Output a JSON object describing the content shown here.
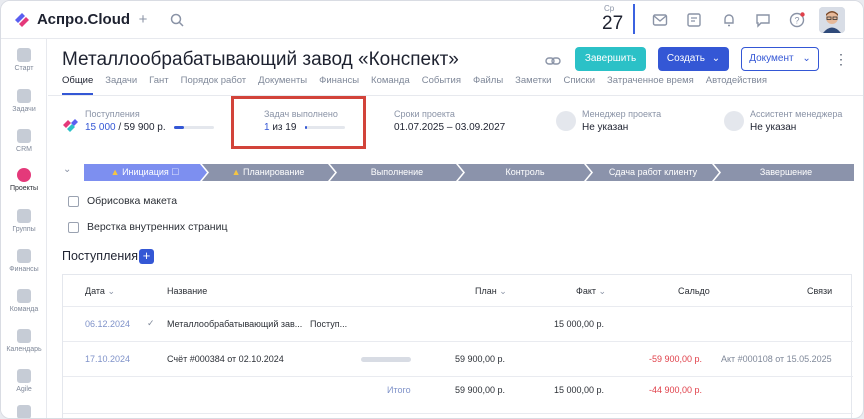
{
  "app": {
    "name": "Аспро.Cloud"
  },
  "topbar": {
    "day_of_week": "Ср",
    "day": "27"
  },
  "sidebar": {
    "items": [
      {
        "label": "Старт",
        "icon": "home-icon"
      },
      {
        "label": "Задачи",
        "icon": "tasks-icon"
      },
      {
        "label": "CRM",
        "icon": "crm-icon"
      },
      {
        "label": "Проекты",
        "icon": "projects-icon"
      },
      {
        "label": "Группы",
        "icon": "groups-icon"
      },
      {
        "label": "Финансы",
        "icon": "finance-icon"
      },
      {
        "label": "Команда",
        "icon": "team-icon"
      },
      {
        "label": "Календарь",
        "icon": "calendar-icon"
      },
      {
        "label": "Agile",
        "icon": "agile-icon"
      }
    ]
  },
  "project": {
    "title": "Металлообрабатывающий завод «Конспект»",
    "btn_finish": "Завершить",
    "btn_create": "Создать",
    "btn_document": "Документ"
  },
  "tabs": [
    "Общие",
    "Задачи",
    "Гант",
    "Порядок работ",
    "Документы",
    "Финансы",
    "Команда",
    "События",
    "Файлы",
    "Заметки",
    "Списки",
    "Затраченное время",
    "Автодействия"
  ],
  "stats": {
    "income_label": "Поступления",
    "income_paid": "15 000",
    "income_total": " / 59 900 р.",
    "income_progress": 0.25,
    "tasks_label": "Задач выполнено",
    "tasks_done": "1",
    "tasks_total": " из 19",
    "tasks_progress": 0.05,
    "deadline_label": "Сроки проекта",
    "deadline_value": "01.07.2025  –  03.09.2027",
    "manager_label": "Менеджер проекта",
    "manager_value": "Не указан",
    "assistant_label": "Ассистент менеджера",
    "assistant_value": "Не указан"
  },
  "stages": [
    "Инициация",
    "Планирование",
    "Выполнение",
    "Контроль",
    "Сдача работ клиенту",
    "Завершение"
  ],
  "checklist": [
    "Обрисовка макета",
    "Верстка внутренних страниц"
  ],
  "payments": {
    "title": "Поступления",
    "columns": [
      "Дата",
      "Название",
      "План",
      "Факт",
      "Сальдо",
      "Связи"
    ],
    "rows": [
      {
        "date": "06.12.2024",
        "name": "Металлообрабатывающий зав...",
        "type": "Поступ...",
        "plan": "",
        "fact": "15 000,00 р.",
        "saldo": "",
        "link": ""
      },
      {
        "date": "17.10.2024",
        "name": "Счёт #000384 от 02.10.2024",
        "type": "",
        "plan": "59 900,00 р.",
        "fact": "",
        "saldo": "-59 900,00 р.",
        "link": "Акт #000108 от 15.05.2025"
      }
    ],
    "total": {
      "label": "Итого",
      "plan": "59 900,00 р.",
      "fact": "15 000,00 р.",
      "saldo": "-44 900,00 р."
    }
  }
}
